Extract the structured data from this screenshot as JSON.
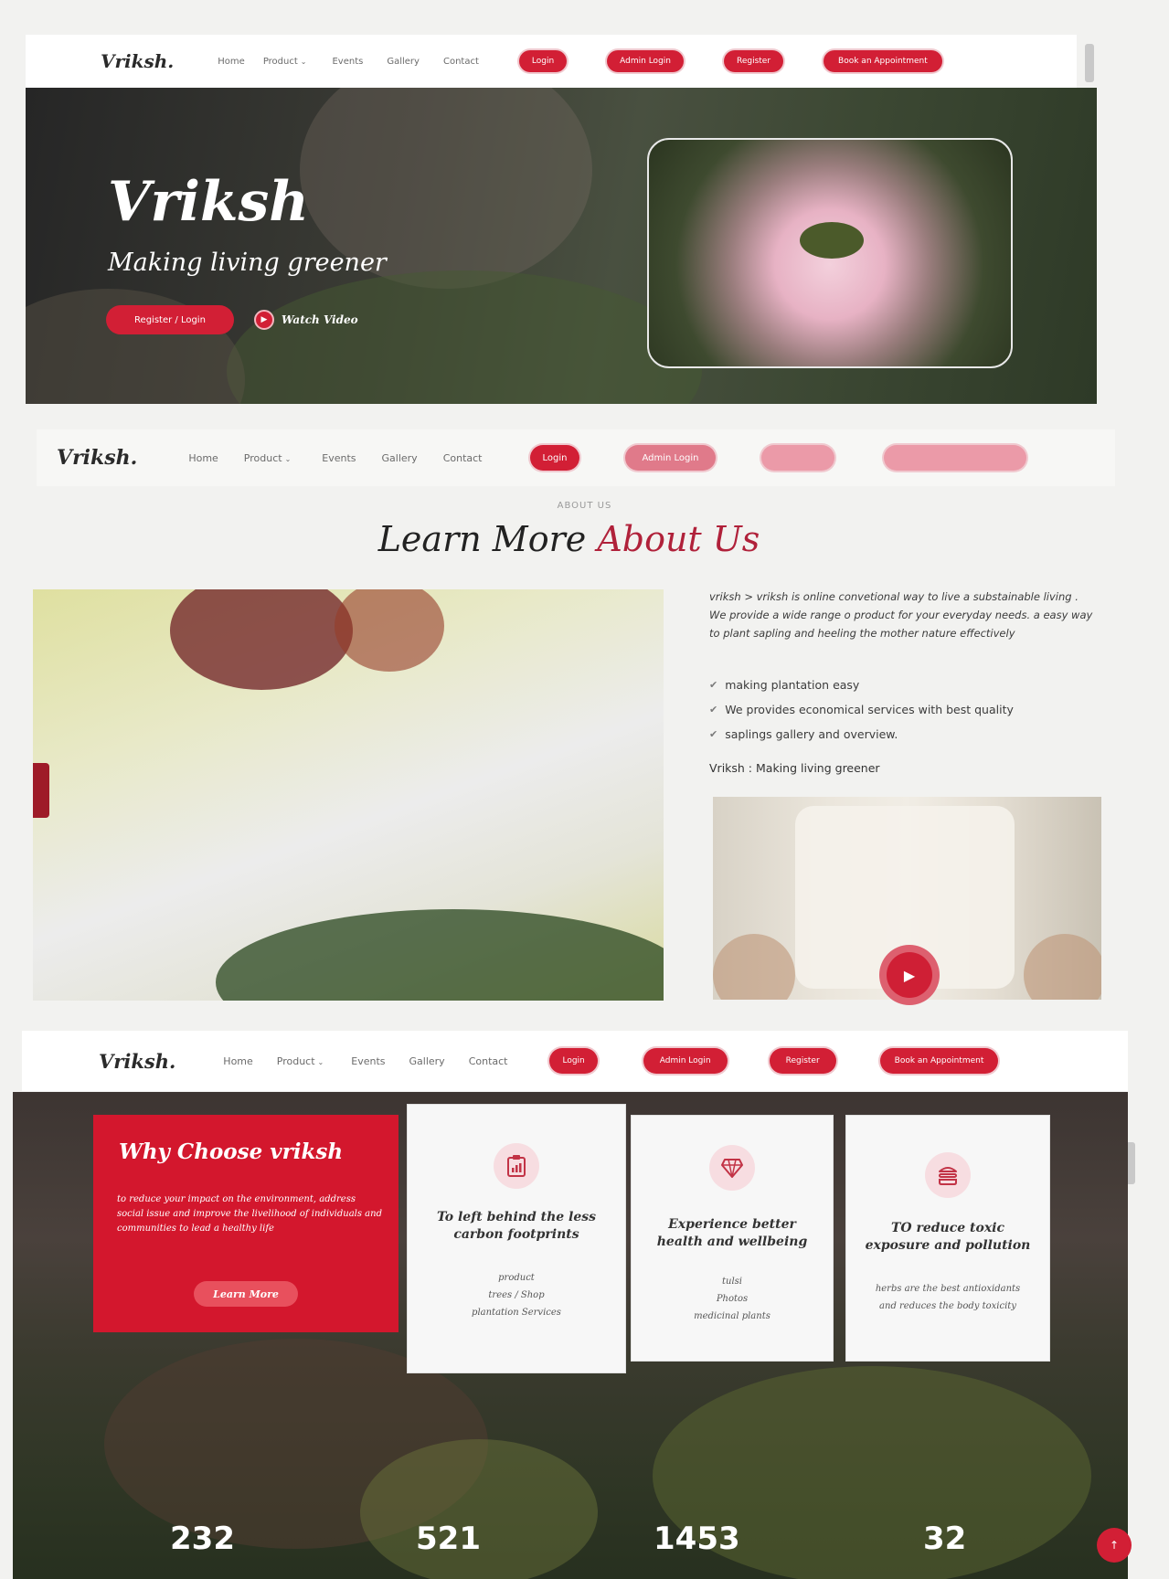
{
  "brand": "Vriksh.",
  "nav": {
    "links": [
      "Home",
      "Product",
      "Events",
      "Gallery",
      "Contact"
    ],
    "buttons": [
      "Login",
      "Admin Login",
      "Register",
      "Book an Appointment"
    ]
  },
  "hero": {
    "title": "Vriksh",
    "subtitle": "Making living greener",
    "cta": "Register / Login",
    "watch_video": "Watch Video"
  },
  "about": {
    "eyebrow": "ABOUT US",
    "title_main": "Learn More ",
    "title_accent": "About Us",
    "description": "vriksh > vriksh is online convetional way to live a substainable living . We provide a wide range o product for your everyday needs. a easy way to plant sapling and heeling the mother nature effectively",
    "checks": [
      "making plantation easy",
      "We provides economical services with best quality",
      "saplings gallery and overview."
    ],
    "tagline": "Vriksh : Making living greener"
  },
  "why": {
    "title": "Why Choose vriksh",
    "text": "to reduce your impact on the environment, address social issue and improve the livelihood of individuals and communities to lead a healthy life",
    "button": "Learn More",
    "features": [
      {
        "icon": "clipboard-chart-icon",
        "title": "To left behind the less carbon footprints",
        "lines": [
          "product",
          "trees / Shop",
          "plantation Services"
        ]
      },
      {
        "icon": "gem-icon",
        "title": "Experience better health and wellbeing",
        "lines": [
          "tulsi",
          "Photos",
          "medicinal plants"
        ]
      },
      {
        "icon": "layers-icon",
        "title": "TO reduce toxic exposure and pollution",
        "lines": [
          "herbs are the best antioxidants",
          "and reduces the body toxicity"
        ]
      }
    ]
  },
  "stats": [
    "232",
    "521",
    "1453",
    "32"
  ],
  "colors": {
    "accent": "#d21f35",
    "accent_dark": "#b0213a"
  }
}
